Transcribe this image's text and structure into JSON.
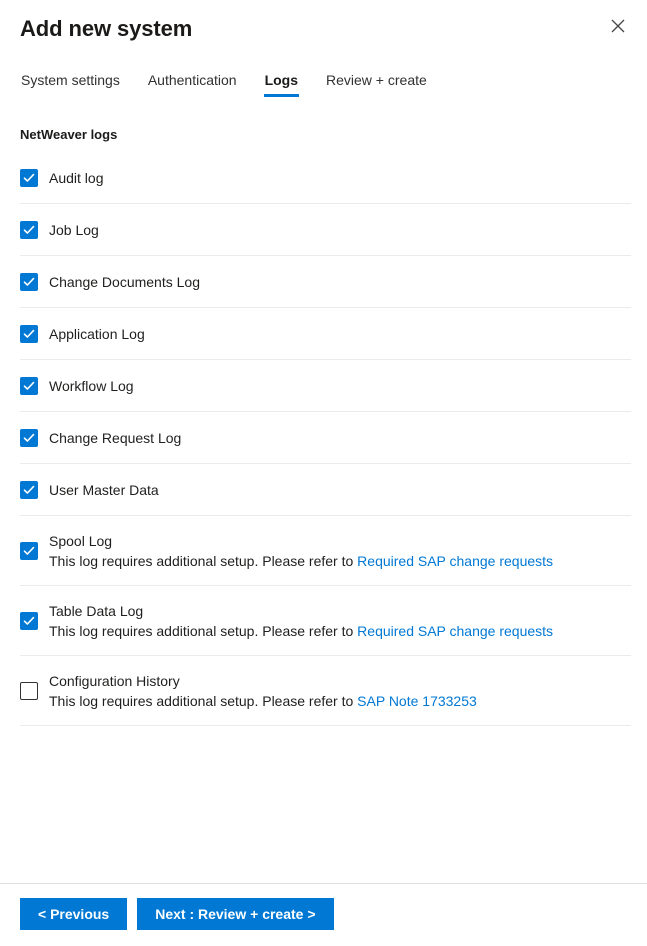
{
  "header": {
    "title": "Add new system",
    "close_label": "×"
  },
  "tabs": [
    {
      "label": "System settings",
      "active": false
    },
    {
      "label": "Authentication",
      "active": false
    },
    {
      "label": "Logs",
      "active": true
    },
    {
      "label": "Review + create",
      "active": false
    }
  ],
  "section": {
    "label": "NetWeaver logs"
  },
  "logs": [
    {
      "name": "Audit log",
      "checked": true,
      "note": "",
      "link": ""
    },
    {
      "name": "Job Log",
      "checked": true,
      "note": "",
      "link": ""
    },
    {
      "name": "Change Documents Log",
      "checked": true,
      "note": "",
      "link": ""
    },
    {
      "name": "Application Log",
      "checked": true,
      "note": "",
      "link": ""
    },
    {
      "name": "Workflow Log",
      "checked": true,
      "note": "",
      "link": ""
    },
    {
      "name": "Change Request Log",
      "checked": true,
      "note": "",
      "link": ""
    },
    {
      "name": "User Master Data",
      "checked": true,
      "note": "",
      "link": ""
    },
    {
      "name": "Spool Log",
      "checked": true,
      "note": "This log requires additional setup. Please refer to ",
      "link": "Required SAP change requests"
    },
    {
      "name": "Table Data Log",
      "checked": true,
      "note": "This log requires additional setup. Please refer to ",
      "link": "Required SAP change requests"
    },
    {
      "name": "Configuration History",
      "checked": false,
      "note": "This log requires additional setup. Please refer to ",
      "link": "SAP Note 1733253"
    }
  ],
  "footer": {
    "previous_label": "< Previous",
    "next_label": "Next : Review + create >"
  },
  "colors": {
    "accent": "#0078d4",
    "link": "#0078d4",
    "text": "#201f1e",
    "divider": "#edebe9"
  }
}
